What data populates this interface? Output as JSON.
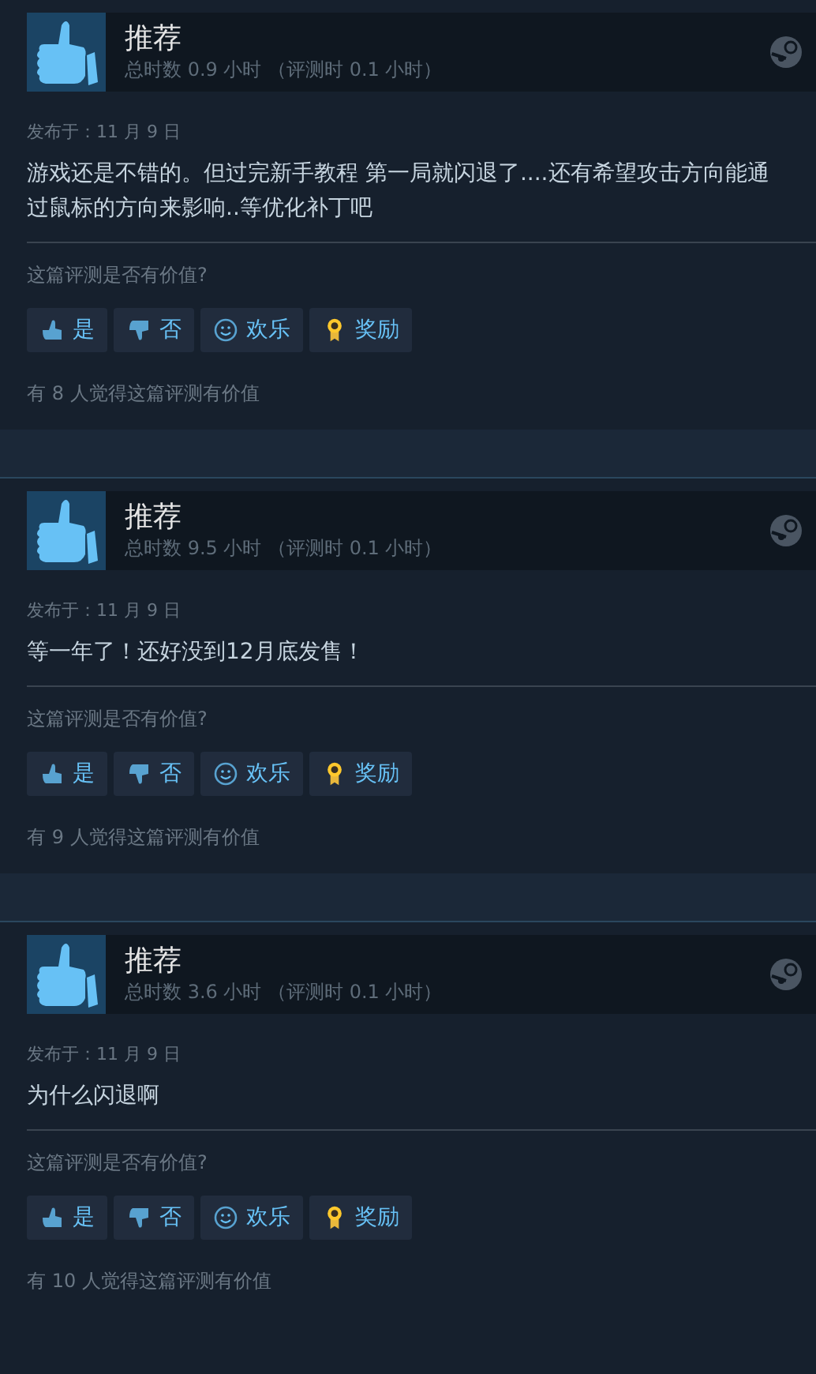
{
  "reviews": [
    {
      "title": "推荐",
      "hours": "总时数 0.9 小时 （评测时 0.1 小时）",
      "posted": "发布于：11 月 9 日",
      "body": "游戏还是不错的。但过完新手教程 第一局就闪退了....还有希望攻击方向能通过鼠标的方向来影响..等优化补丁吧",
      "question": "这篇评测是否有价值?",
      "buttons": [
        {
          "kind": "yes",
          "label": "是"
        },
        {
          "kind": "no",
          "label": "否"
        },
        {
          "kind": "funny",
          "label": "欢乐"
        },
        {
          "kind": "award",
          "label": "奖励"
        }
      ],
      "helpful": "有 8 人觉得这篇评测有价值"
    },
    {
      "title": "推荐",
      "hours": "总时数 9.5 小时 （评测时 0.1 小时）",
      "posted": "发布于：11 月 9 日",
      "body": "等一年了！还好没到12月底发售！",
      "question": "这篇评测是否有价值?",
      "buttons": [
        {
          "kind": "yes",
          "label": "是"
        },
        {
          "kind": "no",
          "label": "否"
        },
        {
          "kind": "funny",
          "label": "欢乐"
        },
        {
          "kind": "award",
          "label": "奖励"
        }
      ],
      "helpful": "有 9 人觉得这篇评测有价值"
    },
    {
      "title": "推荐",
      "hours": "总时数 3.6 小时 （评测时 0.1 小时）",
      "posted": "发布于：11 月 9 日",
      "body": "为什么闪退啊",
      "question": "这篇评测是否有价值?",
      "buttons": [
        {
          "kind": "yes",
          "label": "是"
        },
        {
          "kind": "no",
          "label": "否"
        },
        {
          "kind": "funny",
          "label": "欢乐"
        },
        {
          "kind": "award",
          "label": "奖励"
        }
      ],
      "helpful": "有 10 人觉得这篇评测有价值"
    }
  ]
}
